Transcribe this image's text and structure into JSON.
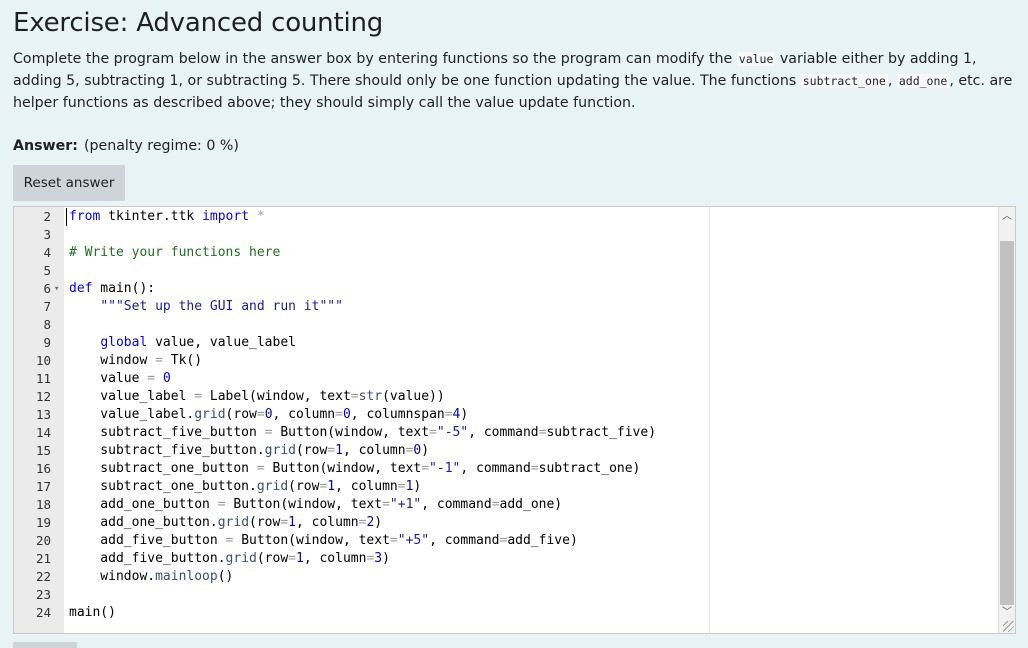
{
  "title": "Exercise: Advanced counting",
  "prompt": {
    "part1": "Complete the program below in the answer box by entering functions so the program can modify the ",
    "code1": "value",
    "part2": " variable either by adding 1, adding 5, subtracting 1, or subtracting 5. There should only be one function updating the value. The functions ",
    "code2": "subtract_one",
    "part3": ", ",
    "code3": "add_one",
    "part4": ", etc. are helper functions as described above; they should simply call the value update function."
  },
  "answer": {
    "label": "Answer:",
    "penalty": "(penalty regime: 0 %)"
  },
  "reset_label": "Reset answer",
  "editor": {
    "line_numbers": [
      "2",
      "3",
      "4",
      "5",
      "6",
      "7",
      "8",
      "9",
      "10",
      "11",
      "12",
      "13",
      "14",
      "15",
      "16",
      "17",
      "18",
      "19",
      "20",
      "21",
      "22",
      "23",
      "24"
    ],
    "scroll_up_icon": "chevron-up-icon",
    "scroll_down_icon": "chevron-down-icon"
  }
}
